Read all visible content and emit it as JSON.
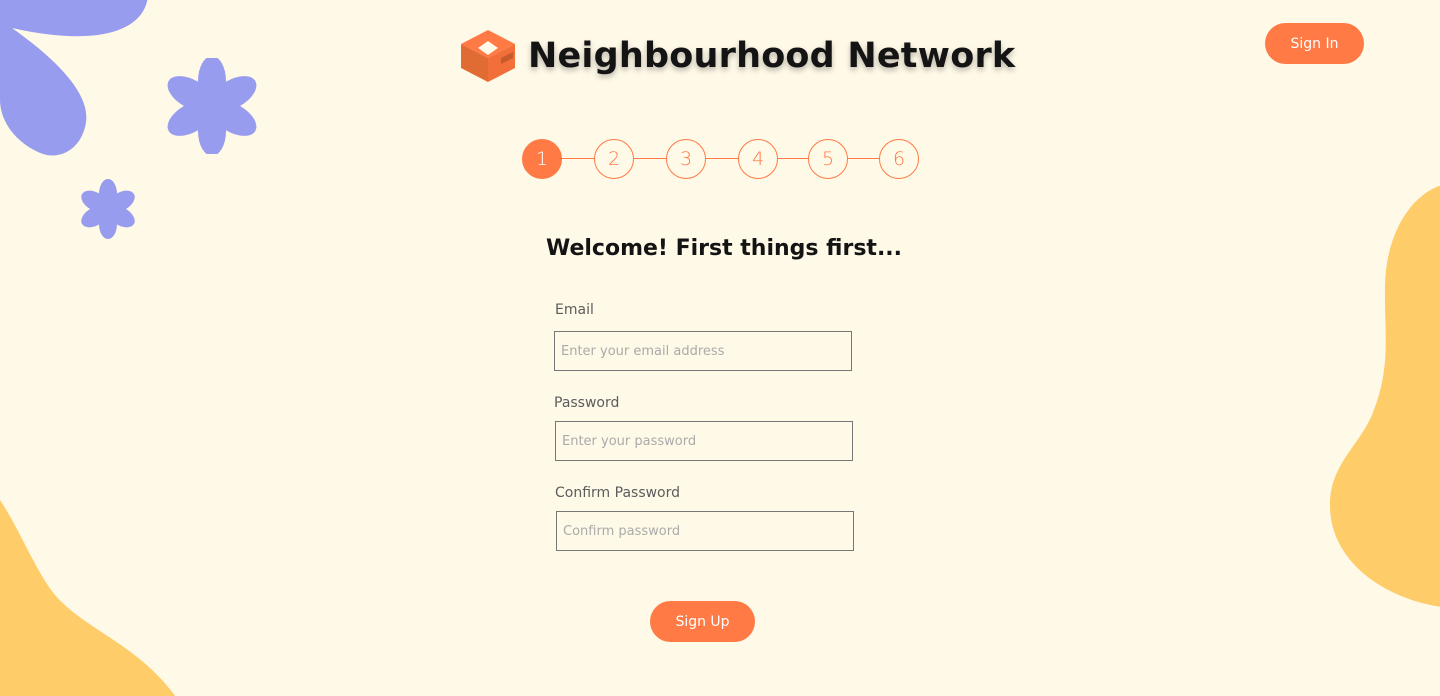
{
  "brand": {
    "name": "Neighbourhood Network",
    "logo_icon": "diamond-frame-logo-icon"
  },
  "header": {
    "signin_label": "Sign In"
  },
  "stepper": {
    "current_step": 1,
    "steps": [
      "1",
      "2",
      "3",
      "4",
      "5",
      "6"
    ]
  },
  "form": {
    "heading": "Welcome! First things first...",
    "email": {
      "label": "Email",
      "placeholder": "Enter your email address",
      "value": ""
    },
    "password": {
      "label": "Password",
      "placeholder": "Enter your password",
      "value": ""
    },
    "confirm_password": {
      "label": "Confirm Password",
      "placeholder": "Confirm password",
      "value": ""
    },
    "signup_label": "Sign Up"
  },
  "colors": {
    "background": "#FFF9E8",
    "accent": "#FF7A45",
    "flower": "#979CEE",
    "blob": "#FFCC6A",
    "text": "#141414"
  },
  "decorations": [
    "flower-petal-icon",
    "flower-icon",
    "flower-icon",
    "yellow-blob",
    "yellow-blob"
  ]
}
